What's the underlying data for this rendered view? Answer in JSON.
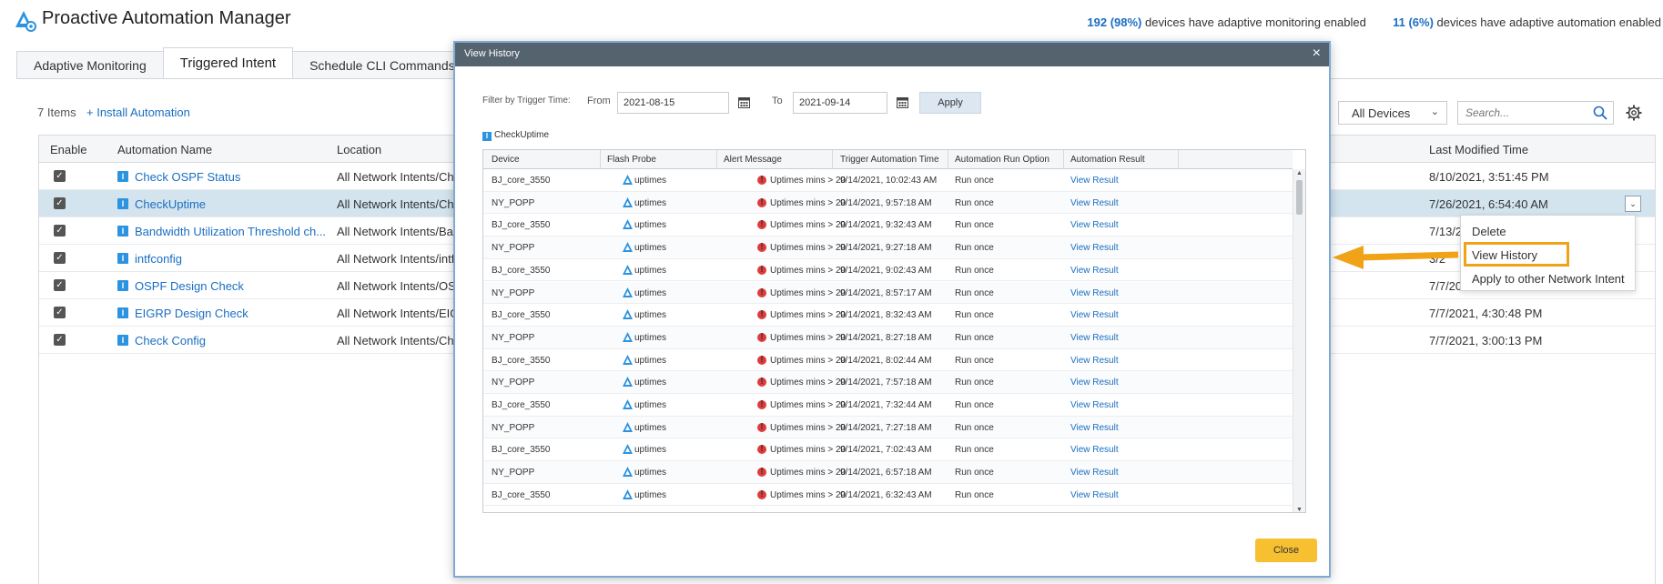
{
  "app": {
    "title": "Proactive Automation Manager",
    "stats": {
      "monitoring_count": "192 (98%)",
      "monitoring_text": "devices have adaptive monitoring enabled",
      "automation_count": "11 (6%)",
      "automation_text": "devices have adaptive automation enabled"
    }
  },
  "tabs": [
    {
      "label": "Adaptive Monitoring",
      "active": false
    },
    {
      "label": "Triggered Intent",
      "active": true
    },
    {
      "label": "Schedule CLI Commands",
      "active": false
    }
  ],
  "toolbar": {
    "items_count": "7 Items",
    "install_link": "+ Install Automation",
    "device_filter": "All Devices",
    "search_placeholder": "Search..."
  },
  "main_table": {
    "columns": {
      "enable": "Enable",
      "name": "Automation Name",
      "location": "Location",
      "modified": "Last Modified Time"
    },
    "rows": [
      {
        "name": "Check OSPF Status",
        "location": "All Network Intents/Che",
        "modified": "8/10/2021, 3:51:45 PM",
        "enabled": true
      },
      {
        "name": "CheckUptime",
        "location": "All Network Intents/Che",
        "modified": "7/26/2021, 6:54:40 AM",
        "enabled": true
      },
      {
        "name": "Bandwidth Utilization Threshold ch...",
        "location": "All Network Intents/Ban",
        "modified": "7/13/2",
        "enabled": true
      },
      {
        "name": "intfconfig",
        "location": "All Network Intents/intf",
        "modified": "3/2",
        "enabled": true
      },
      {
        "name": "OSPF Design Check",
        "location": "All Network Intents/OSI",
        "modified": "7/7/20",
        "enabled": true
      },
      {
        "name": "EIGRP Design Check",
        "location": "All Network Intents/EIG",
        "modified": "7/7/2021, 4:30:48 PM",
        "enabled": true
      },
      {
        "name": "Check Config",
        "location": "All Network Intents/Che",
        "modified": "7/7/2021, 3:00:13 PM",
        "enabled": true
      }
    ]
  },
  "context_menu": {
    "items": [
      "Delete",
      "View History",
      "Apply to other Network Intent"
    ]
  },
  "modal": {
    "title": "View History",
    "filter_label": "Filter by Trigger Time:",
    "from_label": "From",
    "from_value": "2021-08-15",
    "to_label": "To",
    "to_value": "2021-09-14",
    "apply_label": "Apply",
    "intent_name": "CheckUptime",
    "columns": {
      "device": "Device",
      "probe": "Flash Probe",
      "alert": "Alert Message",
      "trigger": "Trigger Automation Time",
      "run_option": "Automation Run Option",
      "result": "Automation Result"
    },
    "rows": [
      {
        "device": "BJ_core_3550",
        "probe": "uptimes",
        "alert": "Uptimes mins > 20",
        "trigger": "9/14/2021, 10:02:43 AM",
        "run_option": "Run once",
        "result": "View Result"
      },
      {
        "device": "NY_POPP",
        "probe": "uptimes",
        "alert": "Uptimes mins > 20",
        "trigger": "9/14/2021, 9:57:18 AM",
        "run_option": "Run once",
        "result": "View Result"
      },
      {
        "device": "BJ_core_3550",
        "probe": "uptimes",
        "alert": "Uptimes mins > 20",
        "trigger": "9/14/2021, 9:32:43 AM",
        "run_option": "Run once",
        "result": "View Result"
      },
      {
        "device": "NY_POPP",
        "probe": "uptimes",
        "alert": "Uptimes mins > 20",
        "trigger": "9/14/2021, 9:27:18 AM",
        "run_option": "Run once",
        "result": "View Result"
      },
      {
        "device": "BJ_core_3550",
        "probe": "uptimes",
        "alert": "Uptimes mins > 20",
        "trigger": "9/14/2021, 9:02:43 AM",
        "run_option": "Run once",
        "result": "View Result"
      },
      {
        "device": "NY_POPP",
        "probe": "uptimes",
        "alert": "Uptimes mins > 20",
        "trigger": "9/14/2021, 8:57:17 AM",
        "run_option": "Run once",
        "result": "View Result"
      },
      {
        "device": "BJ_core_3550",
        "probe": "uptimes",
        "alert": "Uptimes mins > 20",
        "trigger": "9/14/2021, 8:32:43 AM",
        "run_option": "Run once",
        "result": "View Result"
      },
      {
        "device": "NY_POPP",
        "probe": "uptimes",
        "alert": "Uptimes mins > 20",
        "trigger": "9/14/2021, 8:27:18 AM",
        "run_option": "Run once",
        "result": "View Result"
      },
      {
        "device": "BJ_core_3550",
        "probe": "uptimes",
        "alert": "Uptimes mins > 20",
        "trigger": "9/14/2021, 8:02:44 AM",
        "run_option": "Run once",
        "result": "View Result"
      },
      {
        "device": "NY_POPP",
        "probe": "uptimes",
        "alert": "Uptimes mins > 20",
        "trigger": "9/14/2021, 7:57:18 AM",
        "run_option": "Run once",
        "result": "View Result"
      },
      {
        "device": "BJ_core_3550",
        "probe": "uptimes",
        "alert": "Uptimes mins > 20",
        "trigger": "9/14/2021, 7:32:44 AM",
        "run_option": "Run once",
        "result": "View Result"
      },
      {
        "device": "NY_POPP",
        "probe": "uptimes",
        "alert": "Uptimes mins > 20",
        "trigger": "9/14/2021, 7:27:18 AM",
        "run_option": "Run once",
        "result": "View Result"
      },
      {
        "device": "BJ_core_3550",
        "probe": "uptimes",
        "alert": "Uptimes mins > 20",
        "trigger": "9/14/2021, 7:02:43 AM",
        "run_option": "Run once",
        "result": "View Result"
      },
      {
        "device": "NY_POPP",
        "probe": "uptimes",
        "alert": "Uptimes mins > 20",
        "trigger": "9/14/2021, 6:57:18 AM",
        "run_option": "Run once",
        "result": "View Result"
      },
      {
        "device": "BJ_core_3550",
        "probe": "uptimes",
        "alert": "Uptimes mins > 20",
        "trigger": "9/14/2021, 6:32:43 AM",
        "run_option": "Run once",
        "result": "View Result"
      }
    ],
    "close_label": "Close"
  },
  "colors": {
    "link": "#1a6ec2",
    "accent_orange": "#f0a317",
    "modal_header": "#55636f",
    "close_button": "#f6c030",
    "selected_row": "#d3e4ee"
  },
  "icons": {
    "logo": "automation-logo-icon",
    "probe": "flash-probe-icon",
    "alert": "alert-icon",
    "calendar": "calendar-icon",
    "search": "search-icon",
    "settings": "gear-icon"
  }
}
